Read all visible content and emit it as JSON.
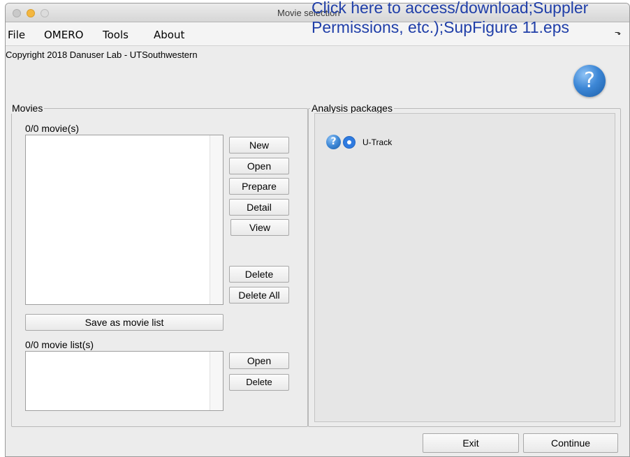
{
  "window": {
    "title": "Movie selection"
  },
  "menubar": {
    "items": [
      "File",
      "OMERO",
      "Tools",
      "About"
    ]
  },
  "header": {
    "copyright": "Copyright 2018 Danuser Lab - UTSouthwestern",
    "help_icon": "?"
  },
  "movies_panel": {
    "title": "Movies",
    "movie_count": "0/0 movie(s)",
    "movie_buttons": [
      "New",
      "Open",
      "Prepare",
      "Detail",
      "View",
      "Delete",
      "Delete All"
    ],
    "save_list_label": "Save as movie list",
    "list_count": "0/0 movie list(s)",
    "list_buttons": [
      "Open",
      "Delete"
    ]
  },
  "analysis_panel": {
    "title": "Analysis packages",
    "packages": [
      {
        "help_icon": "?",
        "label": "U-Track",
        "selected": true
      }
    ]
  },
  "footer": {
    "exit_label": "Exit",
    "continue_label": "Continue"
  },
  "overlay": {
    "line1": "Click here to access/download;Suppler",
    "line2": "Permissions, etc.);SupFigure 11.eps",
    "icon": "⬎"
  },
  "colors": {
    "accent": "#2f7be0",
    "link": "#1f3ea8"
  }
}
